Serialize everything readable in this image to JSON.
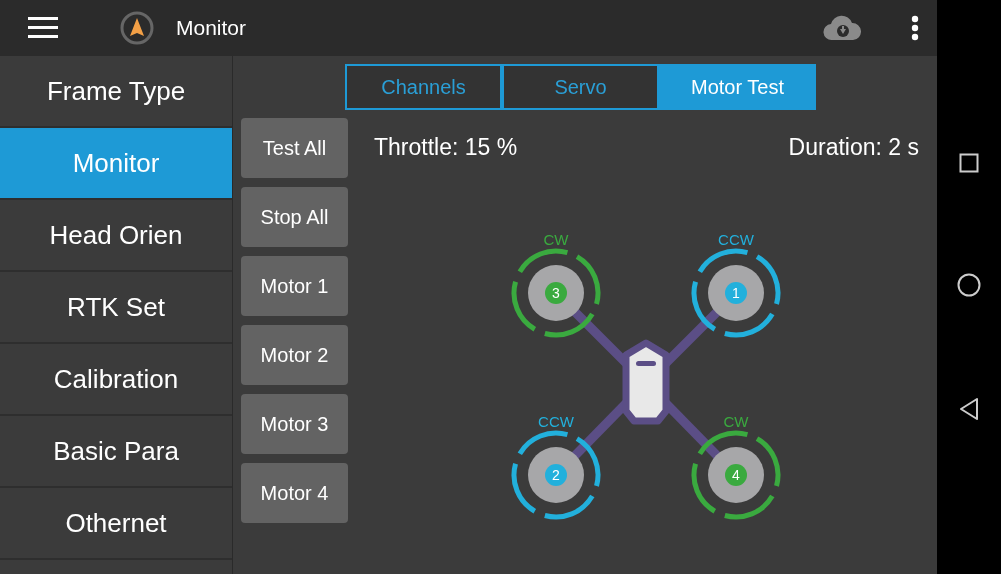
{
  "app_bar": {
    "title": "Monitor"
  },
  "sidebar": {
    "items": [
      {
        "label": "Frame Type",
        "selected": false
      },
      {
        "label": "Monitor",
        "selected": true
      },
      {
        "label": "Head Orien",
        "selected": false
      },
      {
        "label": "RTK Set",
        "selected": false
      },
      {
        "label": "Calibration",
        "selected": false
      },
      {
        "label": "Basic Para",
        "selected": false
      },
      {
        "label": "Othernet",
        "selected": false
      }
    ]
  },
  "tabs": [
    {
      "label": "Channels",
      "selected": false
    },
    {
      "label": "Servo",
      "selected": false
    },
    {
      "label": "Motor Test",
      "selected": true
    }
  ],
  "buttons": [
    "Test All",
    "Stop All",
    "Motor 1",
    "Motor 2",
    "Motor 3",
    "Motor 4"
  ],
  "throttle": "Throttle: 15 %",
  "duration": "Duration: 2 s",
  "motors": [
    {
      "number": "3",
      "direction": "CW",
      "color": "#3aaa3f"
    },
    {
      "number": "1",
      "direction": "CCW",
      "color": "#22b0dc"
    },
    {
      "number": "2",
      "direction": "CCW",
      "color": "#22b0dc"
    },
    {
      "number": "4",
      "direction": "CW",
      "color": "#3aaa3f"
    }
  ]
}
